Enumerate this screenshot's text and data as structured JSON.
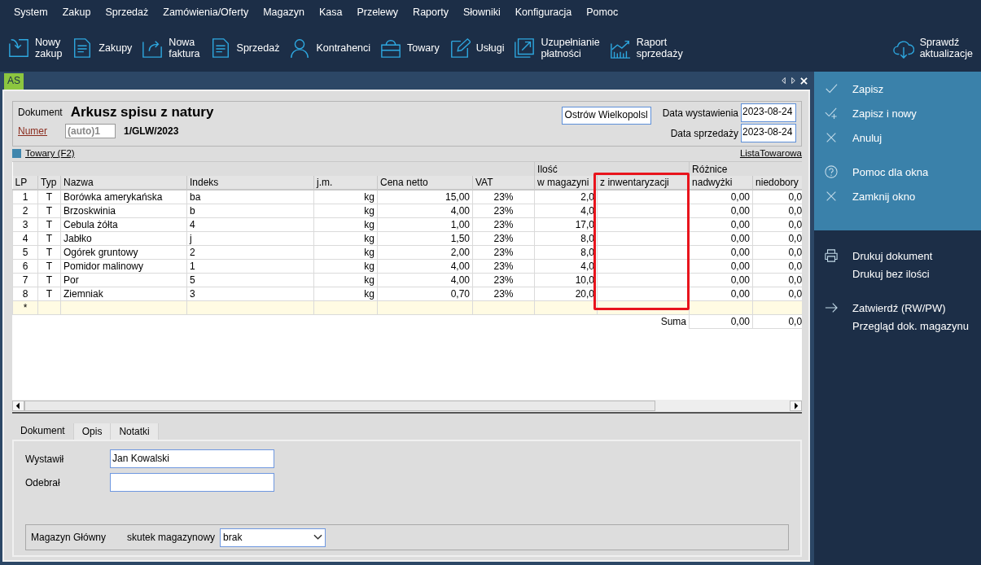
{
  "menu": [
    "System",
    "Zakup",
    "Sprzedaż",
    "Zamówienia/Oferty",
    "Magazyn",
    "Kasa",
    "Przelewy",
    "Raporty",
    "Słowniki",
    "Konfiguracja",
    "Pomoc"
  ],
  "toolbar": [
    "Nowy\nzakup",
    "Zakupy",
    "Nowa\nfaktura",
    "Sprzedaż",
    "Kontrahenci",
    "Towary",
    "Usługi",
    "Uzupełnianie\npłatności",
    "Raport\nsprzedaży"
  ],
  "update_button": "Sprawdź\naktualizacje",
  "window_tab": "AS",
  "document": {
    "label": "Dokument",
    "title": "Arkusz spisu z natury",
    "number_link": "Numer",
    "number_field": "(auto)1",
    "number": "1/GLW/2023",
    "place": "Ostrów Wielkopolsl",
    "issue_label": "Data wystawienia",
    "issue_date": "2023-08-24",
    "sale_label": "Data sprzedaży",
    "sale_date": "2023-08-24"
  },
  "goods_link": "Towary (F2)",
  "list_link": "ListaTowarowa",
  "table": {
    "groups": [
      {
        "label": "Ilość"
      },
      {
        "label": "Różnice"
      }
    ],
    "columns": [
      {
        "label": "LP",
        "highlighted": false
      },
      {
        "label": "Typ",
        "highlighted": false
      },
      {
        "label": "Nazwa",
        "highlighted": false
      },
      {
        "label": "Indeks",
        "highlighted": false
      },
      {
        "label": "j.m.",
        "highlighted": false
      },
      {
        "label": "Cena netto",
        "highlighted": false
      },
      {
        "label": "VAT",
        "highlighted": false
      },
      {
        "label": "w magazyni",
        "highlighted": false
      },
      {
        "label": "z inwentaryzacji",
        "highlighted": true
      },
      {
        "label": "nadwyżki",
        "highlighted": false
      },
      {
        "label": "niedobory",
        "highlighted": false
      }
    ],
    "rows": [
      {
        "lp": "1",
        "type": "T",
        "name": "Borówka amerykańska",
        "index": "ba",
        "unit": "kg",
        "net_price": "15,00",
        "vat": "23%",
        "in_stock": "2,0",
        "surplus": "0,00",
        "shortage": "0,0"
      },
      {
        "lp": "2",
        "type": "T",
        "name": "Brzoskwinia",
        "index": "b",
        "unit": "kg",
        "net_price": "4,00",
        "vat": "23%",
        "in_stock": "4,0",
        "surplus": "0,00",
        "shortage": "0,0"
      },
      {
        "lp": "3",
        "type": "T",
        "name": "Cebula żółta",
        "index": "4",
        "unit": "kg",
        "net_price": "1,00",
        "vat": "23%",
        "in_stock": "17,0",
        "surplus": "0,00",
        "shortage": "0,0"
      },
      {
        "lp": "4",
        "type": "T",
        "name": "Jabłko",
        "index": "j",
        "unit": "kg",
        "net_price": "1,50",
        "vat": "23%",
        "in_stock": "8,0",
        "surplus": "0,00",
        "shortage": "0,0"
      },
      {
        "lp": "5",
        "type": "T",
        "name": "Ogórek gruntowy",
        "index": "2",
        "unit": "kg",
        "net_price": "2,00",
        "vat": "23%",
        "in_stock": "8,0",
        "surplus": "0,00",
        "shortage": "0,0"
      },
      {
        "lp": "6",
        "type": "T",
        "name": "Pomidor malinowy",
        "index": "1",
        "unit": "kg",
        "net_price": "4,00",
        "vat": "23%",
        "in_stock": "4,0",
        "surplus": "0,00",
        "shortage": "0,0"
      },
      {
        "lp": "7",
        "type": "T",
        "name": "Por",
        "index": "5",
        "unit": "kg",
        "net_price": "4,00",
        "vat": "23%",
        "in_stock": "10,0",
        "surplus": "0,00",
        "shortage": "0,0"
      },
      {
        "lp": "8",
        "type": "T",
        "name": "Ziemniak",
        "index": "3",
        "unit": "kg",
        "net_price": "0,70",
        "vat": "23%",
        "in_stock": "20,0",
        "surplus": "0,00",
        "shortage": "0,0"
      }
    ],
    "new_row_mark": "*",
    "sum_label": "Suma",
    "sum_surplus": "0,00",
    "sum_shortage": "0,0"
  },
  "bottom_tabs": [
    {
      "label": "Dokument",
      "selected": true
    },
    {
      "label": "Opis",
      "selected": false
    },
    {
      "label": "Notatki",
      "selected": false
    }
  ],
  "issued_label": "Wystawił",
  "issued_value": "Jan Kowalski",
  "received_label": "Odebrał",
  "warehouse": "Magazyn Główny",
  "effect_label": "skutek magazynowy",
  "effect_value": "brak",
  "side_top": [
    [
      "Zapisz",
      "Zapisz i nowy",
      "Anuluj"
    ],
    [
      "Pomoc dla okna",
      "Zamknij okno"
    ]
  ],
  "side_bottom": [
    [
      "Drukuj dokument",
      "Drukuj bez ilości"
    ],
    [
      "Zatwierdź (RW/PW)",
      "Przegląd dok. magazynu"
    ]
  ]
}
